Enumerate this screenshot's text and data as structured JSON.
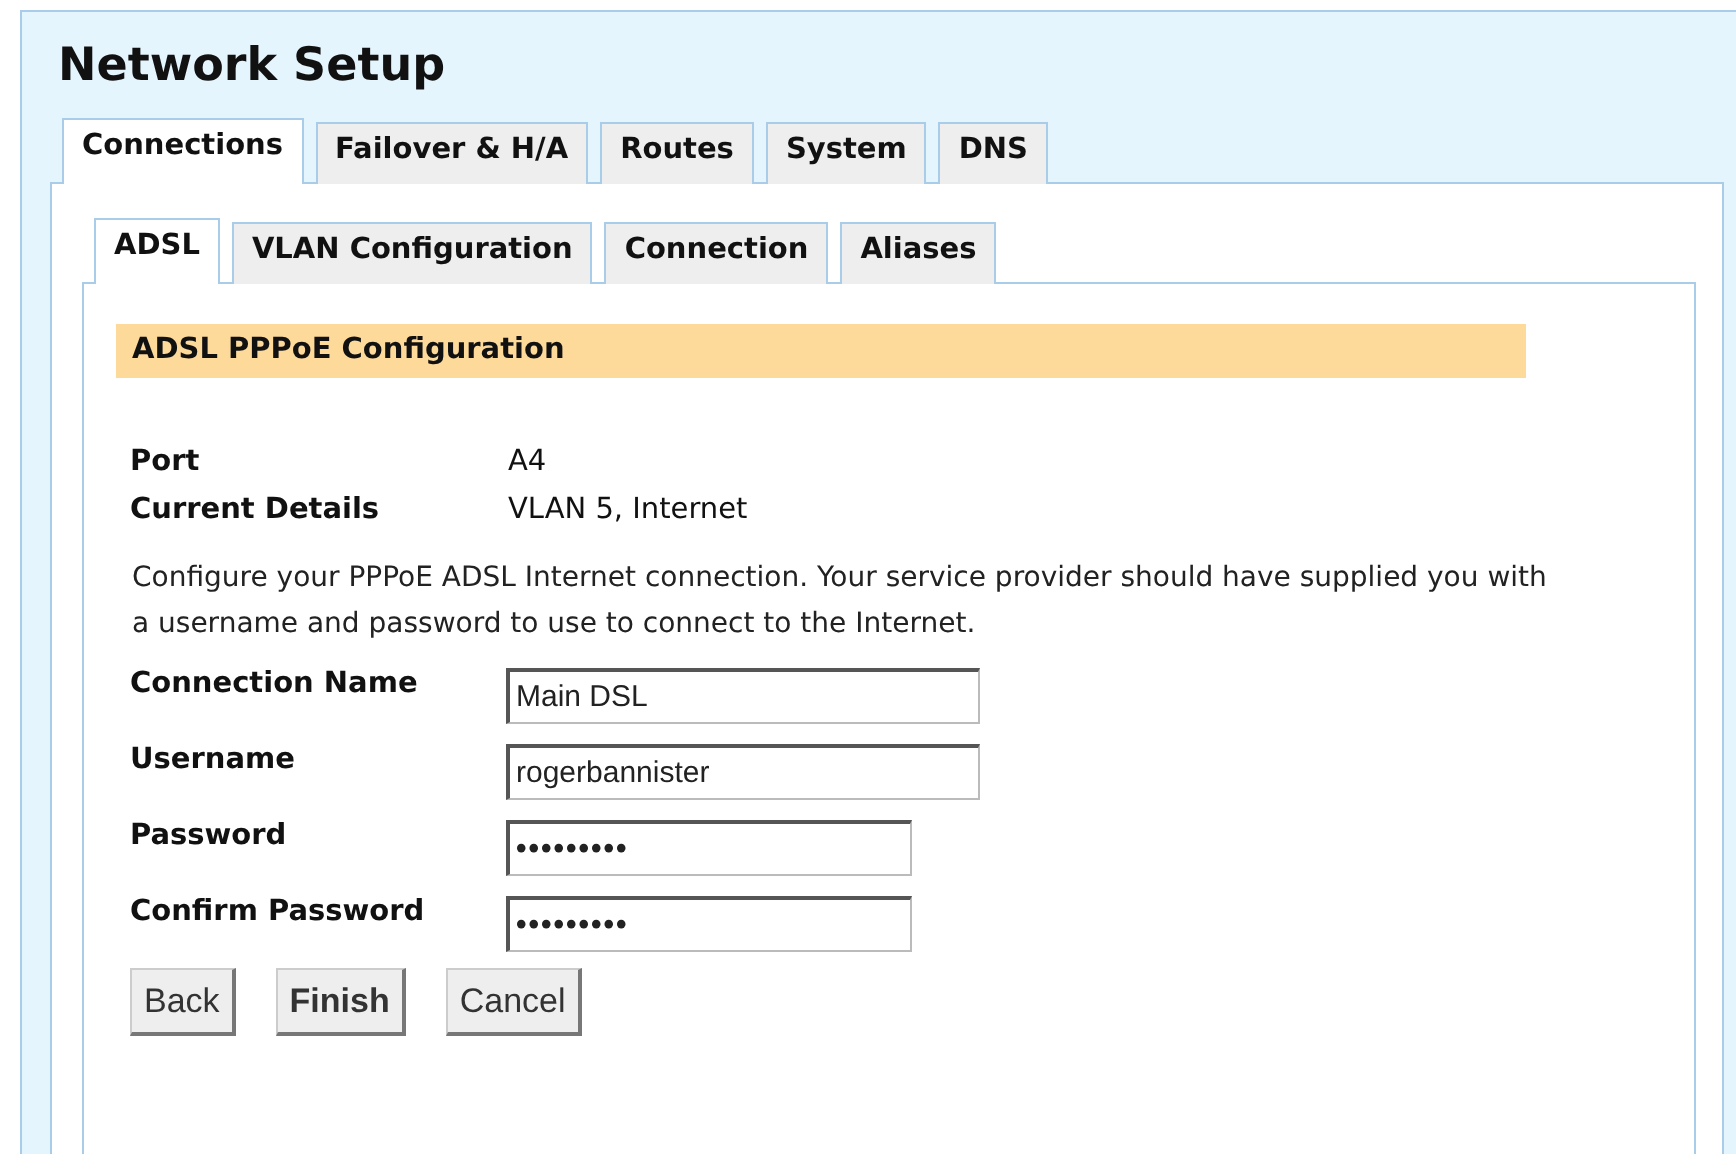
{
  "title": "Network Setup",
  "tabs": [
    {
      "label": "Connections",
      "selected": true
    },
    {
      "label": "Failover & H/A",
      "selected": false
    },
    {
      "label": "Routes",
      "selected": false
    },
    {
      "label": "System",
      "selected": false
    },
    {
      "label": "DNS",
      "selected": false
    }
  ],
  "subtabs": [
    {
      "label": "ADSL",
      "selected": true
    },
    {
      "label": "VLAN Configuration",
      "selected": false
    },
    {
      "label": "Connection",
      "selected": false
    },
    {
      "label": "Aliases",
      "selected": false
    }
  ],
  "section_title": "ADSL PPPoE Configuration",
  "details": [
    {
      "label": "Port",
      "value": "A4"
    },
    {
      "label": "Current Details",
      "value": "VLAN 5, Internet"
    }
  ],
  "description": "Configure your PPPoE ADSL Internet connection. Your service provider should have supplied you with a username and password to use to connect to the Internet.",
  "fields": [
    {
      "label": "Connection Name",
      "value": "Main DSL",
      "kind": "text"
    },
    {
      "label": "Username",
      "value": "rogerbannister",
      "kind": "text"
    },
    {
      "label": "Password",
      "value": "•••••••••",
      "kind": "password"
    },
    {
      "label": "Confirm Password",
      "value": "•••••••••",
      "kind": "password"
    }
  ],
  "buttons": [
    {
      "label": "Back",
      "default": false
    },
    {
      "label": "Finish",
      "default": true
    },
    {
      "label": "Cancel",
      "default": false
    }
  ]
}
